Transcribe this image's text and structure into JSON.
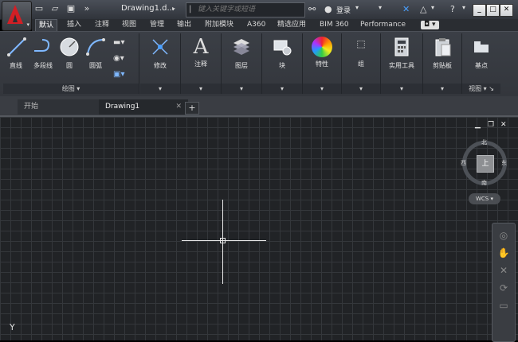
{
  "titlebar": {
    "document_title": "Drawing1.d...",
    "search_placeholder": "键入关键字或短语",
    "login_label": "登录"
  },
  "ribbon_tabs": [
    "默认",
    "插入",
    "注释",
    "视图",
    "管理",
    "输出",
    "附加模块",
    "A360",
    "精选应用",
    "BIM 360",
    "Performance"
  ],
  "ribbon_active_tab": "默认",
  "ribbon": {
    "draw_panel": {
      "footer": "绘图",
      "buttons": [
        "直线",
        "多段线",
        "圆",
        "圆弧"
      ]
    },
    "modify_label": "修改",
    "annotation_label": "注释",
    "layers_label": "图层",
    "block_label": "块",
    "properties_label": "特性",
    "groups_label": "组",
    "utilities_label": "实用工具",
    "clipboard_label": "剪贴板",
    "view_panel": {
      "button": "基点",
      "footer": "视图"
    }
  },
  "file_tabs": {
    "start": "开始",
    "drawing": "Drawing1"
  },
  "viewcube": {
    "top_face": "上",
    "north": "北",
    "south": "南",
    "east": "东",
    "west": "西",
    "wcs": "WCS"
  },
  "ucs_axis": "Y",
  "colors": {
    "accent_red": "#d21f25",
    "canvas_bg": "#212326",
    "grid_line": "#34373b"
  }
}
